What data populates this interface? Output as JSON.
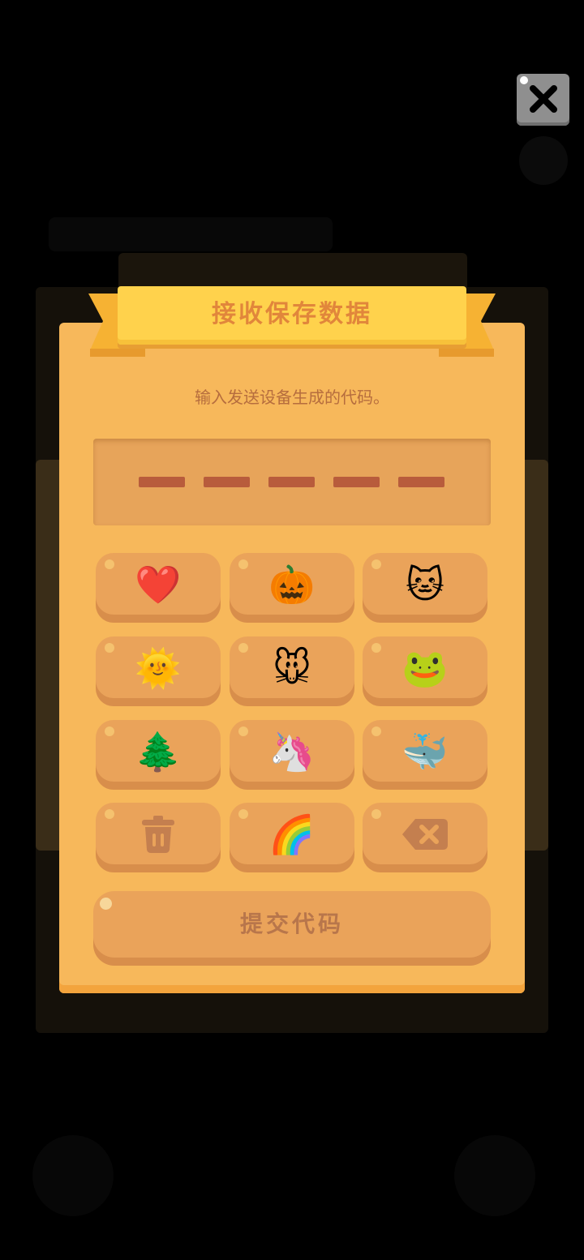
{
  "dialog": {
    "title": "接收保存数据",
    "instruction": "输入发送设备生成的代码。",
    "code_slots": [
      "",
      "",
      "",
      "",
      ""
    ],
    "submit_label": "提交代码"
  },
  "keypad": [
    {
      "glyph": "❤️",
      "icon": "heart-icon"
    },
    {
      "glyph": "🎃",
      "icon": "pumpkin-icon"
    },
    {
      "glyph": "🐱",
      "icon": "cat-icon"
    },
    {
      "glyph": "🌞",
      "icon": "sun-icon"
    },
    {
      "glyph": "🐭",
      "icon": "mouse-icon"
    },
    {
      "glyph": "🐸",
      "icon": "frog-icon"
    },
    {
      "glyph": "🌲",
      "icon": "tree-icon"
    },
    {
      "glyph": "🦄",
      "icon": "unicorn-icon"
    },
    {
      "glyph": "🐳",
      "icon": "whale-icon"
    },
    {
      "glyph": "",
      "icon": "trash-icon"
    },
    {
      "glyph": "🌈",
      "icon": "rainbow-icon"
    },
    {
      "glyph": "",
      "icon": "backspace-icon"
    }
  ],
  "colors": {
    "panel": "#f7b85b",
    "ribbon": "#ffd24c",
    "key": "#eaa35a",
    "title_text": "#e1863b",
    "code_slot": "#b85c3c"
  }
}
